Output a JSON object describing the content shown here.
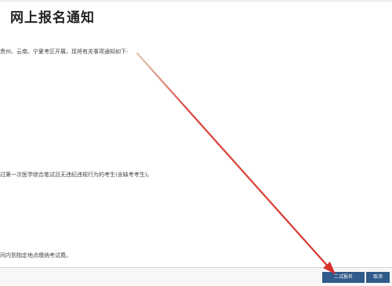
{
  "page": {
    "title": "网上报名通知",
    "paragraphs": [
      "贵州、云南、宁夏考区开展，现将有关事项通知如下:",
      "过第一次医学综合笔试且无违纪违规行为的考生(含缺考考生)。",
      "间内到指定地点缴纳考试费。"
    ]
  },
  "footer": {
    "register_label": "二试报名",
    "cancel_label": "取消"
  },
  "colors": {
    "button_bg": "#2f5a8a",
    "annotation_arrow": "#d8322c"
  },
  "icons": {
    "annotation": "arrow-pointer-icon"
  }
}
